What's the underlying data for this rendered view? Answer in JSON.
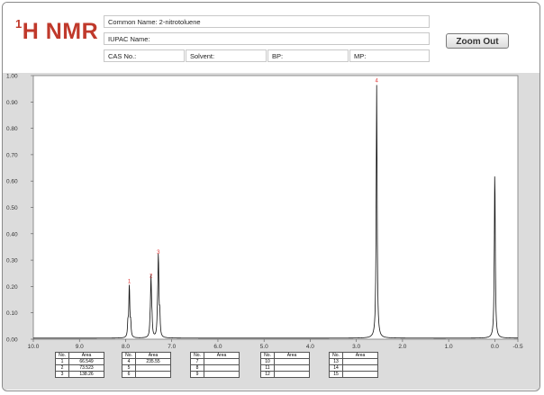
{
  "header": {
    "logo_sup": "1",
    "logo_text": "H NMR",
    "common_name": "Common Name:  2-nitrotoluene",
    "iupac_name": "IUPAC Name:",
    "cas_no": "CAS No.:",
    "solvent": "Solvent:",
    "bp": "BP:",
    "mp": "MP:",
    "zoom_out_label": "Zoom Out"
  },
  "colors": {
    "logo": "#c0392b",
    "peak_label": "#e03030",
    "plot_background": "#dcdcdc"
  },
  "chart_data": {
    "type": "line",
    "x_ticks": [
      "10.0",
      "9.0",
      "8.0",
      "7.0",
      "6.0",
      "5.0",
      "4.0",
      "3.0",
      "2.0",
      "1.0",
      "0.0",
      "-0.5"
    ],
    "y_ticks": [
      "0.00",
      "0.10",
      "0.20",
      "0.30",
      "0.40",
      "0.50",
      "0.60",
      "0.70",
      "0.80",
      "0.90",
      "1.00"
    ],
    "xlim": [
      10.0,
      -0.5
    ],
    "ylim": [
      0.0,
      1.0
    ],
    "grid": false,
    "peaks": [
      {
        "label": "1",
        "ppm": 7.92,
        "height": 0.2
      },
      {
        "label": "2",
        "ppm": 7.45,
        "height": 0.22
      },
      {
        "label": "3",
        "ppm": 7.29,
        "height": 0.31
      },
      {
        "label": "4",
        "ppm": 2.56,
        "height": 0.96
      },
      {
        "label": "",
        "ppm": 0.0,
        "height": 0.64
      }
    ]
  },
  "area_tables": [
    {
      "rows": [
        [
          "1",
          "66.549"
        ],
        [
          "2",
          "73.523"
        ],
        [
          "3",
          "138.26"
        ]
      ]
    },
    {
      "rows": [
        [
          "4",
          "235.55"
        ],
        [
          "5",
          ""
        ],
        [
          "6",
          ""
        ]
      ]
    },
    {
      "rows": [
        [
          "7",
          ""
        ],
        [
          "8",
          ""
        ],
        [
          "9",
          ""
        ]
      ]
    },
    {
      "rows": [
        [
          "10",
          ""
        ],
        [
          "11",
          ""
        ],
        [
          "12",
          ""
        ]
      ]
    },
    {
      "rows": [
        [
          "13",
          ""
        ],
        [
          "14",
          ""
        ],
        [
          "15",
          ""
        ]
      ]
    }
  ],
  "area_table_headers": {
    "no": "No.",
    "area": "Area"
  }
}
